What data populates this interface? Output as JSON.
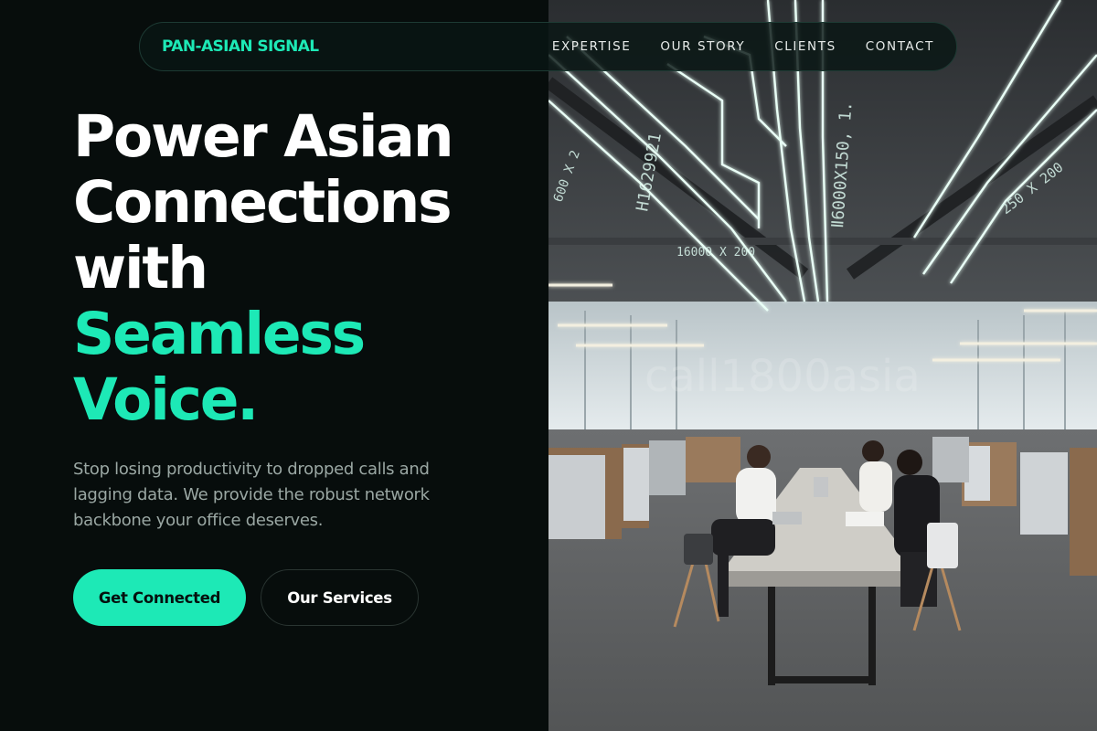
{
  "colors": {
    "accent": "#1de9b6",
    "background": "#070d0c",
    "text_primary": "#ffffff",
    "text_muted": "#9aa7a3"
  },
  "nav": {
    "brand": "PAN-ASIAN SIGNAL",
    "links": [
      "EXPERTISE",
      "OUR STORY",
      "CLIENTS",
      "CONTACT"
    ]
  },
  "hero": {
    "headline_white": [
      "Power Asian",
      "Connections",
      "with"
    ],
    "headline_accent": [
      "Seamless",
      "Voice."
    ],
    "description": "Stop losing productivity to dropped calls and lagging data. We provide the robust network backbone your office deserves.",
    "primary_cta": "Get Connected",
    "secondary_cta": "Our Services"
  },
  "photo": {
    "description_icon": "office-photo",
    "ceiling_texts": [
      "H1629921",
      "Ⅱ6000X150, 1.",
      "600 X 2",
      "250 X 200",
      "16000 X 200"
    ]
  }
}
